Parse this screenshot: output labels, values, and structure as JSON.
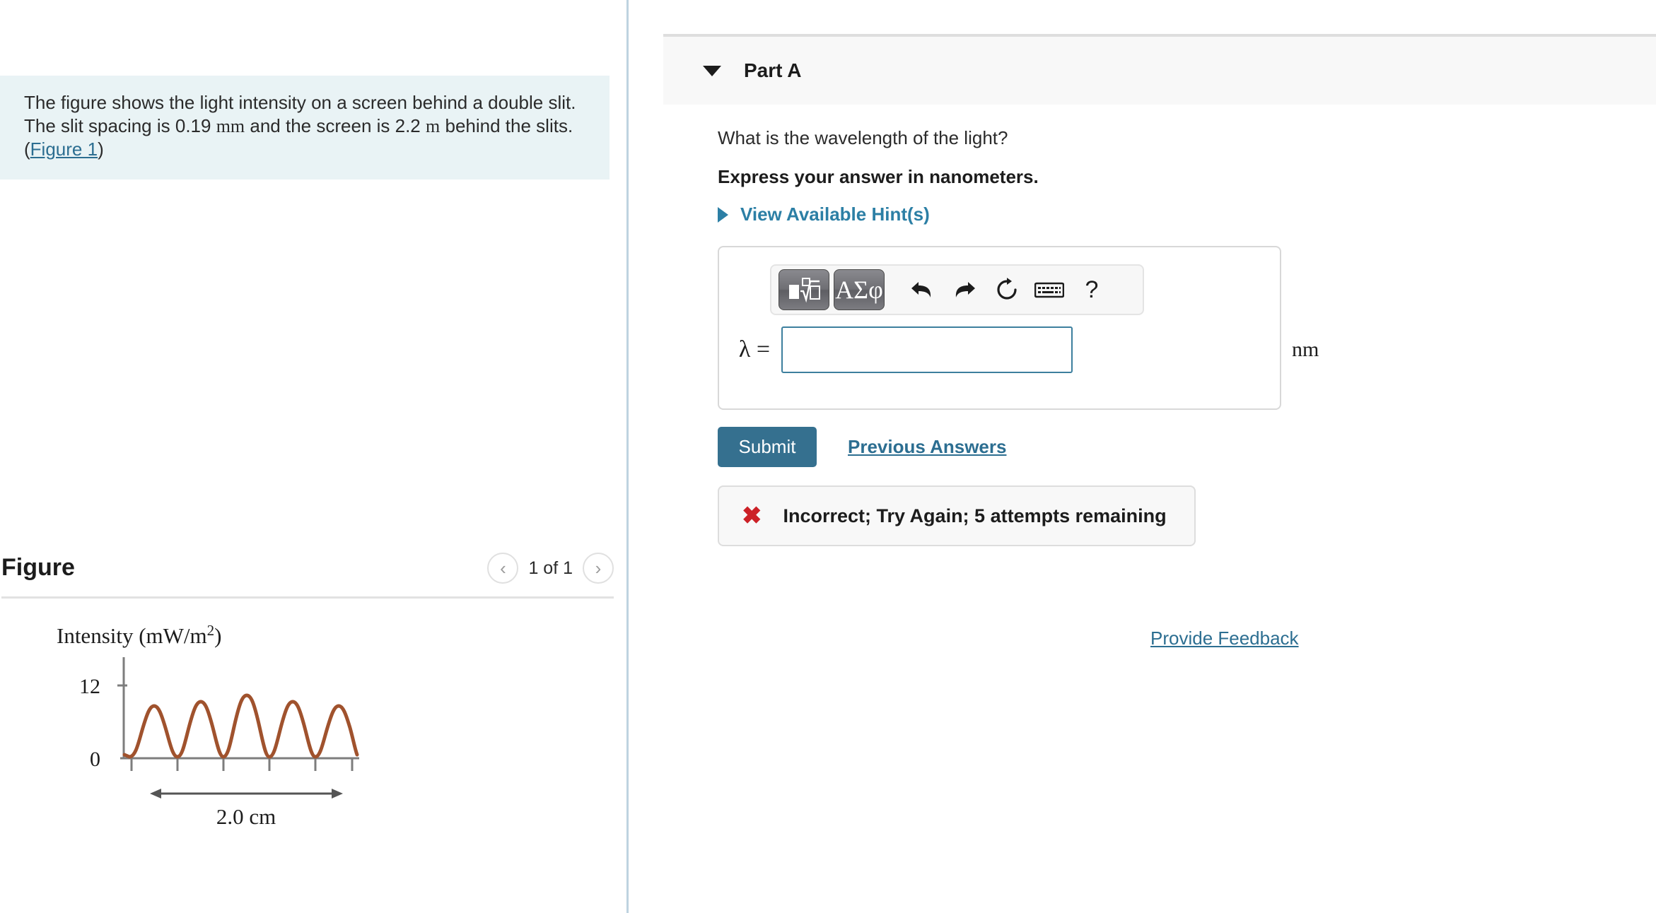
{
  "left": {
    "problem": {
      "line1": "The figure shows the light intensity on a screen behind a double slit.",
      "line2a": "The slit spacing is 0.19",
      "unit_mm": "mm",
      "line2b": "and the screen is 2.2",
      "unit_m": "m",
      "line2c": "behind the",
      "line3_prefix": "slits.(",
      "figure_link": "Figure 1",
      "line3_suffix": ")"
    },
    "figure": {
      "title": "Figure",
      "counter": "1 of 1",
      "prev_icon": "chevron-left-icon",
      "next_icon": "chevron-right-icon"
    }
  },
  "right": {
    "part_header": {
      "label": "Part A",
      "caret_icon": "caret-down-icon"
    },
    "question": "What is the wavelength of the light?",
    "instruction": "Express your answer in nanometers.",
    "hints": {
      "label": "View Available Hint(s)",
      "caret_icon": "caret-right-icon"
    },
    "toolbar": {
      "template_icon": "math-template-icon",
      "greek_label": "ΑΣφ",
      "undo_icon": "undo-arrow-icon",
      "redo_icon": "redo-arrow-icon",
      "reset_icon": "reset-circular-arrow-icon",
      "keyboard_icon": "keyboard-icon",
      "help_label": "?"
    },
    "answer": {
      "symbol": "λ =",
      "value": "",
      "placeholder": "",
      "unit": "nm"
    },
    "submit_label": "Submit",
    "previous_answers_label": "Previous Answers",
    "feedback": {
      "icon": "red-x-icon",
      "message": "Incorrect; Try Again; 5 attempts remaining"
    },
    "provide_feedback_label": "Provide Feedback"
  },
  "colors": {
    "accent_link": "#2c6e91",
    "submit_bg": "#35708f",
    "hint_blue": "#2c7fa5",
    "info_bg": "#e9f3f5",
    "error_red": "#cc2127",
    "curve": "#a0522d",
    "axis": "#6e6e6e"
  },
  "chart_data": {
    "type": "line",
    "title": "",
    "ylabel": "Intensity (mW/m²)",
    "xlabel": "",
    "ytick_labels": [
      "0",
      "12"
    ],
    "ytick_values": [
      0,
      12
    ],
    "ylim": [
      0,
      13.5
    ],
    "grid": false,
    "legend": null,
    "annotation": {
      "text": "2.0 cm",
      "span_fringes": 4,
      "value": 2.0,
      "unit": "cm"
    },
    "peaks": [
      {
        "index": -2,
        "intensity": 10.0
      },
      {
        "index": -1,
        "intensity": 11.0
      },
      {
        "index": 0,
        "intensity": 12.0
      },
      {
        "index": 1,
        "intensity": 11.0
      },
      {
        "index": 2,
        "intensity": 10.0
      }
    ],
    "minima_tick_count": 6,
    "series": [
      {
        "name": "intensity",
        "description": "double-slit interference fringe pattern, 5 bright fringes"
      }
    ]
  }
}
